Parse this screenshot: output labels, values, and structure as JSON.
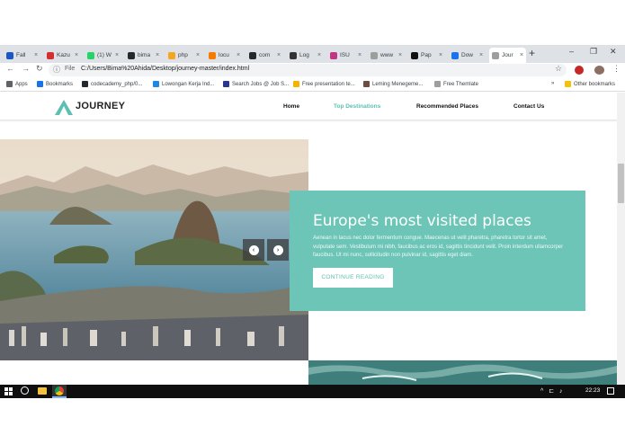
{
  "browser": {
    "tabs": [
      {
        "label": "Fall",
        "color": "#1a56c4"
      },
      {
        "label": "Kazu",
        "color": "#d32f2f"
      },
      {
        "label": "(1) W",
        "color": "#25d366"
      },
      {
        "label": "bima",
        "color": "#24292e"
      },
      {
        "label": "php",
        "color": "#f4a623"
      },
      {
        "label": "locu",
        "color": "#f57c00"
      },
      {
        "label": "com",
        "color": "#24292e"
      },
      {
        "label": "Log",
        "color": "#333333"
      },
      {
        "label": "ISU",
        "color": "#c13584"
      },
      {
        "label": "www",
        "color": "#9e9e9e"
      },
      {
        "label": "Pap",
        "color": "#111111"
      },
      {
        "label": "Dow",
        "color": "#1a73e8"
      },
      {
        "label": "Jour",
        "color": "#9e9e9e"
      }
    ],
    "new_tab_symbol": "+",
    "window_controls": {
      "minimize": "–",
      "maximize": "❐",
      "close": "✕"
    },
    "address": {
      "scheme": "File",
      "url": "C:/Users/Bima%20Ahida/Desktop/journey-master/index.html"
    },
    "bookmarks": [
      {
        "label": "Apps",
        "icon": "apps-icon",
        "color": "#5f6368"
      },
      {
        "label": "Bookmarks",
        "icon": "star-icon",
        "color": "#1a73e8"
      },
      {
        "label": "codecademy_php/0...",
        "icon": "github-icon",
        "color": "#24292e"
      },
      {
        "label": "Lowongan Kerja Ind...",
        "icon": "site-icon",
        "color": "#1e88e5"
      },
      {
        "label": "Search Jobs @ Job S...",
        "icon": "site-icon",
        "color": "#283593"
      },
      {
        "label": "Free presentation te...",
        "icon": "slides-icon",
        "color": "#f4b400"
      },
      {
        "label": "Leming Menegeme...",
        "icon": "site-icon",
        "color": "#6d4c41"
      },
      {
        "label": "Free Themlate",
        "icon": "site-icon",
        "color": "#9e9e9e"
      }
    ],
    "bookmarks_overflow": "»",
    "other_bookmarks": "Other bookmarks"
  },
  "site": {
    "logo": "JOURNEY",
    "nav": [
      "Home",
      "Top Destinations",
      "Recommended Places",
      "Contact Us"
    ],
    "accent": "#5bc0b1"
  },
  "hero": {
    "title": "Europe's most visited places",
    "text": "Aenean in lacus nec dolor fermentum congue. Maecenas ut velit pharetra, pharetra tortor sit amet, vulputate sem. Vestibulum mi nibh, faucibus ac eros id, sagittis tincidunt velit. Proin interdum ullamcorper faucibus. Ut mi nunc, sollicitudin non pulvinar id, sagittis eget diam.",
    "button": "CONTINUE READING",
    "prev_symbol": "‹",
    "next_symbol": "›",
    "card_color": "#6cc5b6"
  },
  "taskbar": {
    "tray": "^ ⊏ ♪",
    "clock": "22:23"
  }
}
